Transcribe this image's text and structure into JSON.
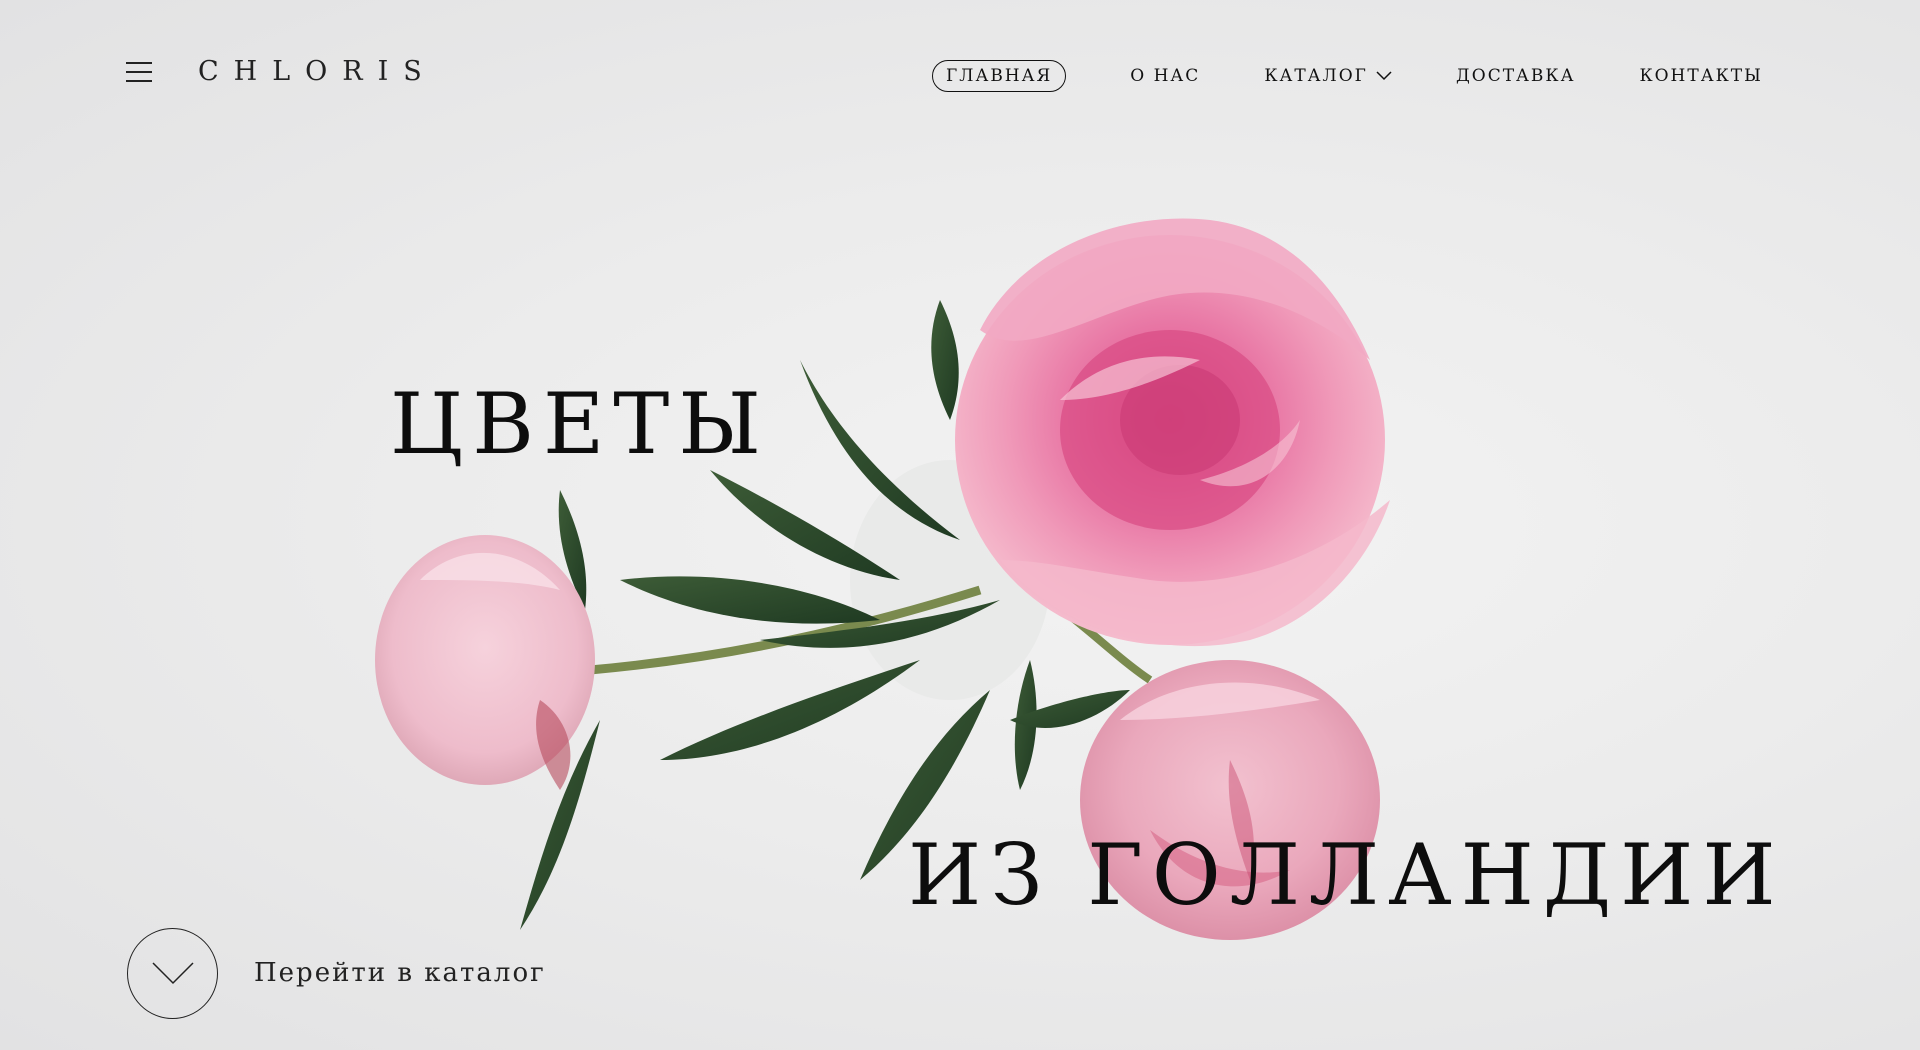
{
  "brand": {
    "logo_text": "CHLORIS"
  },
  "nav": {
    "items": [
      {
        "label": "ГЛАВНАЯ",
        "active": true
      },
      {
        "label": "О НАС"
      },
      {
        "label": "КАТАЛОГ",
        "has_dropdown": true
      },
      {
        "label": "ДОСТАВКА"
      },
      {
        "label": "КОНТАКТЫ"
      }
    ]
  },
  "hero": {
    "line1": "ЦВЕТЫ",
    "line2": "ИЗ ГОЛЛАНДИИ",
    "cta_label": "Перейти в каталог"
  },
  "icons": {
    "menu": "hamburger-icon",
    "dropdown": "chevron-down-icon",
    "cta": "chevron-down-icon"
  },
  "colors": {
    "background": "#ebebeb",
    "text": "#111111",
    "peony_pink": "#e77fa6",
    "peony_light": "#efc5d2",
    "leaf": "#2f4a2c"
  }
}
